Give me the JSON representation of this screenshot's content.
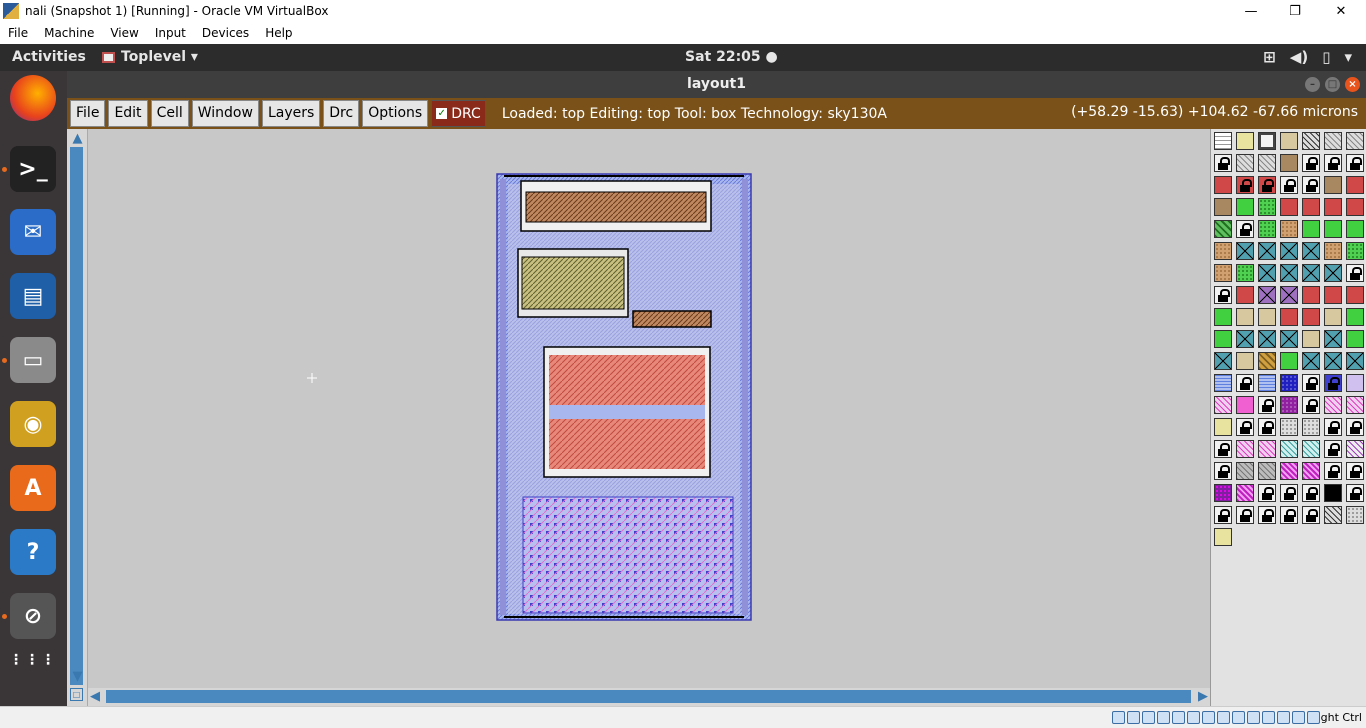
{
  "vbox": {
    "title": "nali (Snapshot 1) [Running] - Oracle VM VirtualBox",
    "controls": {
      "minimize": "—",
      "maximize": "❐",
      "close": "✕"
    },
    "menu": [
      "File",
      "Machine",
      "View",
      "Input",
      "Devices",
      "Help"
    ],
    "host_key": "Right Ctrl"
  },
  "gnome": {
    "activities": "Activities",
    "app_menu": "Toplevel ▾",
    "clock": "Sat 22:05 ●",
    "tray": [
      "network-icon",
      "volume-icon",
      "battery-icon",
      "power-menu-icon"
    ],
    "dock": [
      {
        "name": "firefox-icon",
        "glyph": "",
        "color": "#e8601c",
        "running": false
      },
      {
        "name": "terminal-icon",
        "glyph": ">_",
        "color": "#222222",
        "running": true
      },
      {
        "name": "thunderbird-icon",
        "glyph": "✉",
        "color": "#2a6cc7",
        "running": false
      },
      {
        "name": "writer-icon",
        "glyph": "▤",
        "color": "#1e5fa8",
        "running": false
      },
      {
        "name": "files-icon",
        "glyph": "▭",
        "color": "#8a8a8a",
        "running": true
      },
      {
        "name": "rhythmbox-icon",
        "glyph": "◉",
        "color": "#d0a020",
        "running": false
      },
      {
        "name": "software-icon",
        "glyph": "A",
        "color": "#e86a1a",
        "running": false
      },
      {
        "name": "help-icon",
        "glyph": "?",
        "color": "#2a7ac8",
        "running": false
      },
      {
        "name": "stop-icon",
        "glyph": "⊘",
        "color": "#555555",
        "running": true
      },
      {
        "name": "app-grid-icon",
        "glyph": "⋮⋮⋮",
        "color": "transparent",
        "running": false
      }
    ]
  },
  "magic": {
    "window_title": "layout1",
    "menu": [
      "File",
      "Edit",
      "Cell",
      "Window",
      "Layers",
      "Drc",
      "Options"
    ],
    "drc_label": "DRC",
    "drc_checked": true,
    "status": "Loaded: top Editing: top Tool: box  Technology: sky130A",
    "coords": "(+58.29 -15.63) +104.62 -67.66 microns",
    "colors": {
      "menubar": "#7a5219",
      "canvas": "#c8c8c8",
      "scroll": "#4a88c0"
    }
  },
  "palette": {
    "rows": [
      [
        "grid",
        "yellow",
        "box",
        "tan",
        "hatchdark",
        "hatchgray",
        "hatchgray"
      ],
      [
        "lock",
        "hatchgray",
        "hatchgray",
        "brown",
        "lock",
        "lock",
        "lock"
      ],
      [
        "red",
        "lockred",
        "lockred",
        "lock",
        "lock",
        "brown",
        "red"
      ],
      [
        "brown",
        "green",
        "greendot",
        "red",
        "red",
        "red",
        "red"
      ],
      [
        "greenhatch",
        "lock",
        "greendot",
        "tandot",
        "green",
        "green",
        "green"
      ],
      [
        "tandot",
        "xbox",
        "xbox",
        "xbox",
        "xbox",
        "tandot",
        "greendot"
      ],
      [
        "tandot",
        "greendot",
        "xbox",
        "xbox",
        "xbox",
        "xbox",
        "lock"
      ],
      [
        "lock",
        "red",
        "xviolet",
        "xviolet",
        "red",
        "red",
        "red"
      ],
      [
        "green",
        "tan",
        "tan",
        "red",
        "red",
        "tan",
        "green"
      ],
      [
        "green",
        "xbox",
        "xbox",
        "xbox",
        "tan",
        "xbox",
        "green"
      ],
      [
        "xbox",
        "tan",
        "tanhatch",
        "green",
        "xbox",
        "xbox",
        "xbox"
      ],
      [
        "blue",
        "lock",
        "blue",
        "navy",
        "lock",
        "lockblue",
        "lavender"
      ],
      [
        "pinkhatch",
        "pink",
        "lock",
        "purple",
        "lock",
        "pinkhatch",
        "pinkhatch"
      ],
      [
        "yellow",
        "lock",
        "lock",
        "graydot",
        "graydot",
        "lock",
        "lock"
      ],
      [
        "lock",
        "pinkhatch",
        "pinkhatch",
        "tealhatch",
        "tealhatch",
        "lock",
        "purplehatch"
      ],
      [
        "lock",
        "grayhatch",
        "grayhatch",
        "magenta",
        "magenta",
        "lock",
        "lock"
      ],
      [
        "violet",
        "magenta",
        "lock",
        "lock",
        "lock",
        "black",
        "lock"
      ],
      [
        "lock",
        "lock",
        "lock",
        "lock",
        "lock",
        "hatchdark",
        "graydot"
      ],
      [
        "yellow"
      ]
    ]
  }
}
